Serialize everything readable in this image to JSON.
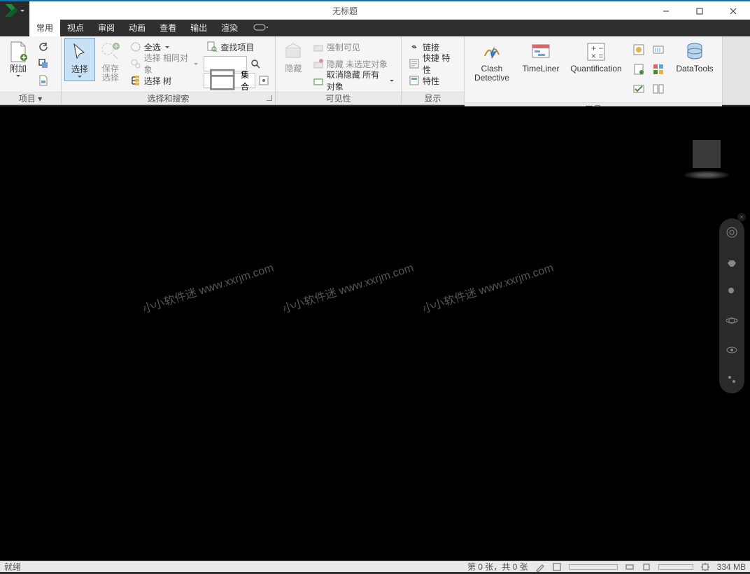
{
  "title": "无标题",
  "tabs": [
    "常用",
    "视点",
    "审阅",
    "动画",
    "查看",
    "输出",
    "渲染"
  ],
  "ribbon": {
    "project": {
      "append": "附加",
      "label": "项目"
    },
    "select": {
      "select": "选择",
      "save_sel": "保存\n选择",
      "all": "全选",
      "same": "选择 相同对象",
      "tree": "选择 树",
      "find": "查找项目",
      "sets": "集合",
      "label": "选择和搜索"
    },
    "visibility": {
      "hide": "隐藏",
      "force": "强制可见",
      "hide_unsel": "隐藏 未选定对象",
      "unhide_all": "取消隐藏 所有对象",
      "label": "可见性"
    },
    "display": {
      "link": "链接",
      "quick": "快捷 特性",
      "props": "特性",
      "label": "显示"
    },
    "tools": {
      "clash": "Clash\nDetective",
      "timeliner": "TimeLiner",
      "quant": "Quantification",
      "datatools": "DataTools",
      "label": "工具"
    }
  },
  "watermarks": [
    "小小软件迷 www.xxrjm.com",
    "小小软件迷 www.xxrjm.com",
    "小小软件迷 www.xxrjm.com"
  ],
  "status": {
    "ready": "就绪",
    "sheet": "第 0 张，共 0 张",
    "mem": "334 MB"
  }
}
